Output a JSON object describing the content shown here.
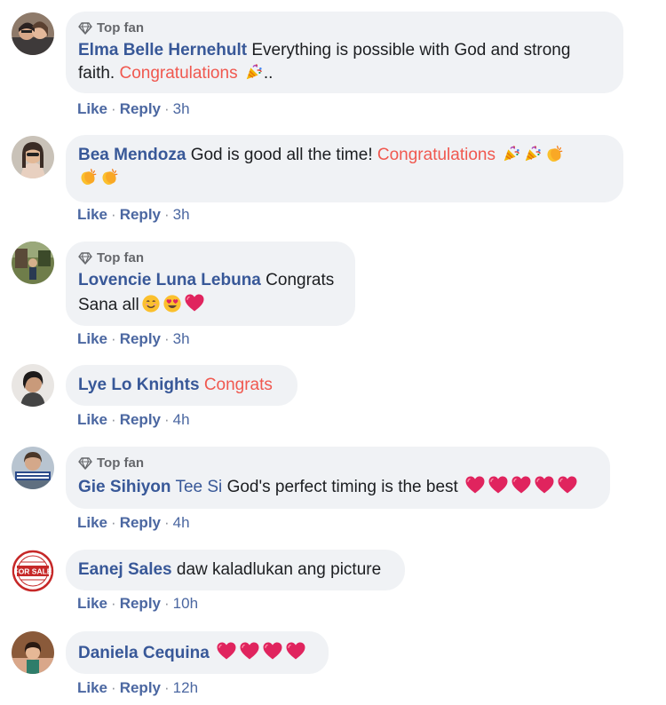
{
  "badge_label": "Top fan",
  "colors": {
    "author": "#385898",
    "highlight": "#f0584f",
    "bubble": "#f0f2f5",
    "action": "#4b67a1"
  },
  "action_labels": {
    "like": "Like",
    "reply": "Reply"
  },
  "comments": [
    {
      "author": "Elma Belle Hernehult",
      "top_fan": true,
      "text_1": "Everything is possible with God and strong",
      "text_2": "faith.",
      "highlight": "Congratulations",
      "tail": "..",
      "emojis": [
        "party-popper"
      ],
      "time": "3h"
    },
    {
      "author": "Bea Mendoza",
      "top_fan": false,
      "text": "God is good all the time!",
      "highlight": "Congratulations",
      "emojis": [
        "party-popper",
        "party-popper",
        "clapping-hands",
        "clapping-hands",
        "clapping-hands"
      ],
      "time": "3h"
    },
    {
      "author": "Lovencie Luna Lebuna",
      "top_fan": true,
      "text_1": "Congrats",
      "text_2": "Sana all",
      "emojis": [
        "smiling-face",
        "heart-eyes-face",
        "red-heart"
      ],
      "time": "3h"
    },
    {
      "author": "Lye Lo Knights",
      "top_fan": false,
      "highlight": "Congrats",
      "time": "4h"
    },
    {
      "author_1": "Gie Sihiyon",
      "author_2": "Tee Si",
      "top_fan": true,
      "text": "God's perfect timing is the best",
      "emojis": [
        "red-heart",
        "red-heart",
        "red-heart",
        "red-heart",
        "red-heart"
      ],
      "time": "4h"
    },
    {
      "author": "Eanej Sales",
      "top_fan": false,
      "text": "daw kaladlukan ang picture",
      "avatar_text": "FOR SALE",
      "time": "10h"
    },
    {
      "author": "Daniela Cequina",
      "top_fan": false,
      "emojis": [
        "red-heart",
        "red-heart",
        "red-heart",
        "red-heart"
      ],
      "time": "12h"
    }
  ]
}
